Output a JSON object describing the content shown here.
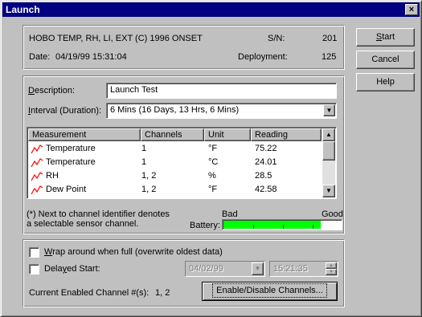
{
  "window": {
    "title": "Launch",
    "close": "×"
  },
  "info": {
    "device": "HOBO TEMP, RH, LI, EXT (C) 1996 ONSET",
    "sn_label": "S/N:",
    "sn_value": "201",
    "date_label": "Date:",
    "date_value": "04/19/99 15:31:04",
    "deployment_label": "Deployment:",
    "deployment_value": "125"
  },
  "buttons": {
    "start": "Start",
    "start_key": "S",
    "cancel": "Cancel",
    "help": "Help"
  },
  "description": {
    "label": "Description:",
    "label_key": "D",
    "value": "Launch Test"
  },
  "interval": {
    "label": "Interval (Duration):",
    "label_key": "I",
    "value": "6 Mins  (16 Days, 13 Hrs, 6 Mins)"
  },
  "table": {
    "headers": [
      "Measurement",
      "Channels",
      "Unit",
      "Reading"
    ],
    "rows": [
      {
        "measurement": "Temperature",
        "channels": "1",
        "unit": "°F",
        "reading": "75.22"
      },
      {
        "measurement": "Temperature",
        "channels": "1",
        "unit": "°C",
        "reading": "24.01"
      },
      {
        "measurement": "RH",
        "channels": "1, 2",
        "unit": "%",
        "reading": "28.5"
      },
      {
        "measurement": "Dew Point",
        "channels": "1, 2",
        "unit": "°F",
        "reading": "42.58"
      }
    ]
  },
  "note": {
    "line1": "(*) Next to channel identifier denotes",
    "line2": "a selectable sensor channel."
  },
  "battery": {
    "label": "Battery:",
    "bad": "Bad",
    "good": "Good",
    "level": 0.83,
    "fill_color": "#00ff00"
  },
  "options": {
    "wrap_label": "Wrap around when full (overwrite oldest data)",
    "wrap_key": "W",
    "wrap_checked": false,
    "delayed_label": "Delayed Start:",
    "delayed_key": "y",
    "delayed_checked": false,
    "delayed_date": "04/02/99",
    "delayed_time": "15:21:35"
  },
  "footer": {
    "channels_label": "Current Enabled Channel #(s):",
    "channels_value": "1, 2",
    "enable_button": "Enable/Disable Channels..."
  },
  "colors": {
    "title_bar": "#000080",
    "face": "#c0c0c0",
    "trend_icon": "#ff0000"
  }
}
